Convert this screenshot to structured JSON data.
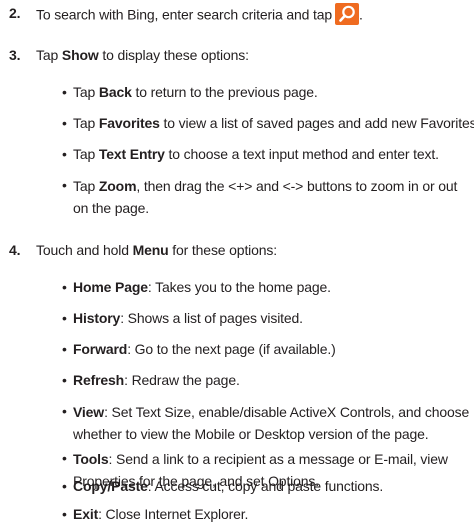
{
  "step2": {
    "number": "2.",
    "text": "To search with Bing, enter search criteria and tap",
    "end": "."
  },
  "step3": {
    "number": "3.",
    "pre": "Tap ",
    "bold": "Show",
    "post": " to display these options:"
  },
  "step3_bullets": [
    {
      "pre": "Tap ",
      "bold": "Back",
      "post": " to return to the previous page."
    },
    {
      "pre": "Tap ",
      "bold": "Favorites",
      "post": " to view a list of saved pages and add new Favorites."
    },
    {
      "pre": "Tap ",
      "bold": "Text Entry",
      "post": " to choose a text input method and enter text."
    },
    {
      "pre": "Tap ",
      "bold": "Zoom",
      "post": ", then drag the <+> and <-> buttons to zoom in or out on the page."
    }
  ],
  "step4": {
    "number": "4.",
    "pre": "Touch and hold ",
    "bold": "Menu",
    "post": " for these options:"
  },
  "step4_bullets": [
    {
      "bold": "Home Page",
      "post": ": Takes you to the home page."
    },
    {
      "bold": "History",
      "post": ": Shows a list of pages visited."
    },
    {
      "bold": "Forward",
      "post": ": Go to the next page (if available.)"
    },
    {
      "bold": "Refresh",
      "post": ": Redraw the page."
    },
    {
      "bold": "View",
      "post": ": Set Text Size, enable/disable ActiveX Controls, and choose whether to view the Mobile or Desktop version of the page."
    },
    {
      "bold": "Tools",
      "post": ": Send a link to a recipient as a message or E-mail, view Properties for the page, and set Options."
    },
    {
      "bold": "Copy/Paste",
      "post": ": Access cut, copy and paste functions."
    },
    {
      "bold": "Exit",
      "post": ": Close Internet Explorer."
    }
  ],
  "bullet_char": "•",
  "icons": {
    "search_button": "search-icon"
  },
  "colors": {
    "text": "#231f20",
    "search_button_bg": "#ef6b20"
  }
}
